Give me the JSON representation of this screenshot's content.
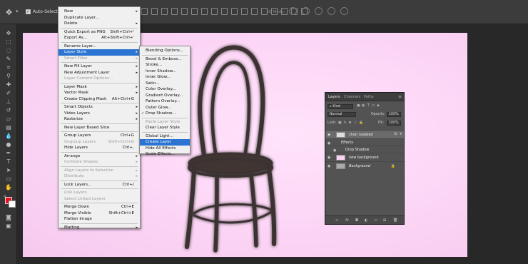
{
  "options_bar": {
    "move_tool_icon": "move-arrows-icon",
    "auto_select_label": "Auto-Select:",
    "mode_3d_label": "3D Mode:"
  },
  "toolbar": {
    "tools": [
      "move-icon",
      "marquee-icon",
      "lasso-icon",
      "quick-select-icon",
      "crop-icon",
      "eyedropper-icon",
      "healing-icon",
      "brush-icon",
      "clone-stamp-icon",
      "history-brush-icon",
      "eraser-icon",
      "gradient-icon",
      "blur-icon",
      "dodge-icon",
      "pen-icon",
      "type-icon",
      "path-select-icon",
      "rectangle-icon",
      "hand-icon",
      "zoom-icon",
      "more-tools-icon"
    ],
    "foreground_color": "#e8101b",
    "background_color": "#ffffff"
  },
  "layer_menu": {
    "items": [
      {
        "label": "New",
        "arrow": true
      },
      {
        "label": "Duplicate Layer..."
      },
      {
        "label": "Delete",
        "arrow": true
      },
      {
        "sep": true
      },
      {
        "label": "Quick Export as PNG",
        "shortcut": "Shift+Ctrl+'"
      },
      {
        "label": "Export As...",
        "shortcut": "Alt+Shift+Ctrl+'"
      },
      {
        "sep": true
      },
      {
        "label": "Rename Layer..."
      },
      {
        "label": "Layer Style",
        "arrow": true,
        "highlight": true
      },
      {
        "label": "Smart Filter",
        "arrow": true,
        "disabled": true
      },
      {
        "sep": true
      },
      {
        "label": "New Fill Layer",
        "arrow": true
      },
      {
        "label": "New Adjustment Layer",
        "arrow": true
      },
      {
        "label": "Layer Content Options...",
        "disabled": true
      },
      {
        "sep": true
      },
      {
        "label": "Layer Mask",
        "arrow": true
      },
      {
        "label": "Vector Mask",
        "arrow": true
      },
      {
        "label": "Create Clipping Mask",
        "shortcut": "Alt+Ctrl+G"
      },
      {
        "sep": true
      },
      {
        "label": "Smart Objects",
        "arrow": true
      },
      {
        "label": "Video Layers",
        "arrow": true
      },
      {
        "label": "Rasterize",
        "arrow": true
      },
      {
        "sep": true
      },
      {
        "label": "New Layer Based Slice"
      },
      {
        "sep": true
      },
      {
        "label": "Group Layers",
        "shortcut": "Ctrl+G"
      },
      {
        "label": "Ungroup Layers",
        "shortcut": "Shift+Ctrl+G",
        "disabled": true
      },
      {
        "label": "Hide Layers",
        "shortcut": "Ctrl+,"
      },
      {
        "sep": true
      },
      {
        "label": "Arrange",
        "arrow": true
      },
      {
        "label": "Combine Shapes",
        "arrow": true,
        "disabled": true
      },
      {
        "sep": true
      },
      {
        "label": "Align Layers to Selection",
        "arrow": true,
        "disabled": true
      },
      {
        "label": "Distribute",
        "arrow": true,
        "disabled": true
      },
      {
        "sep": true
      },
      {
        "label": "Lock Layers...",
        "shortcut": "Ctrl+/"
      },
      {
        "sep": true
      },
      {
        "label": "Link Layers",
        "disabled": true
      },
      {
        "label": "Select Linked Layers",
        "disabled": true
      },
      {
        "sep": true
      },
      {
        "label": "Merge Down",
        "shortcut": "Ctrl+E"
      },
      {
        "label": "Merge Visible",
        "shortcut": "Shift+Ctrl+E"
      },
      {
        "label": "Flatten Image"
      },
      {
        "sep": true
      },
      {
        "label": "Matting",
        "arrow": true
      }
    ]
  },
  "style_menu": {
    "items": [
      {
        "label": "Blending Options..."
      },
      {
        "sep": true
      },
      {
        "label": "Bevel & Emboss..."
      },
      {
        "label": "Stroke..."
      },
      {
        "label": "Inner Shadow..."
      },
      {
        "label": "Inner Glow..."
      },
      {
        "label": "Satin..."
      },
      {
        "label": "Color Overlay..."
      },
      {
        "label": "Gradient Overlay..."
      },
      {
        "label": "Pattern Overlay..."
      },
      {
        "label": "Outer Glow..."
      },
      {
        "label": "Drop Shadow...",
        "checked": true
      },
      {
        "sep": true
      },
      {
        "label": "Paste Layer Style",
        "disabled": true
      },
      {
        "label": "Clear Layer Style"
      },
      {
        "sep": true
      },
      {
        "label": "Global Light..."
      },
      {
        "label": "Create Layer",
        "highlight": true
      },
      {
        "label": "Hide All Effects"
      },
      {
        "label": "Scale Effects..."
      }
    ]
  },
  "layers_panel": {
    "tabs": [
      "Layers",
      "Channels",
      "Paths"
    ],
    "filter_label": "Kind",
    "blend_mode": "Normal",
    "opacity_label": "Opacity:",
    "opacity_value": "100%",
    "lock_label": "Lock:",
    "fill_label": "Fill:",
    "fill_value": "100%",
    "layers": [
      {
        "name": "chair isolated",
        "fx": "fx"
      },
      {
        "name": "Effects"
      },
      {
        "name": "Drop Shadow"
      },
      {
        "name": "new background"
      },
      {
        "name": "Background",
        "locked": true
      }
    ],
    "bottom_icons": [
      "link-icon",
      "fx-icon",
      "mask-icon",
      "adjustment-icon",
      "group-icon",
      "new-layer-icon",
      "trash-icon"
    ]
  }
}
